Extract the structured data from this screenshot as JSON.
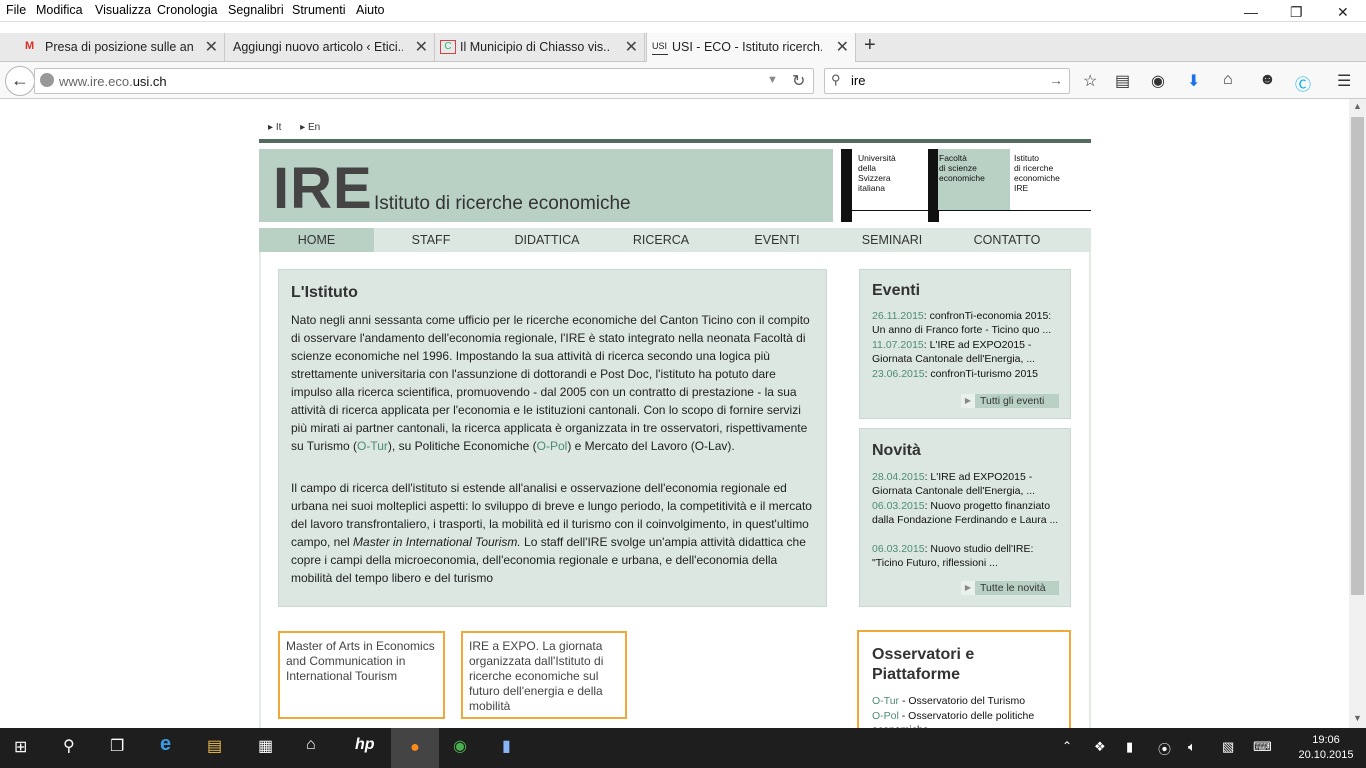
{
  "menu": [
    "File",
    "Modifica",
    "Visualizza",
    "Cronologia",
    "Segnalibri",
    "Strumenti",
    "Aiuto"
  ],
  "window_controls": [
    "—",
    "❐",
    "✕"
  ],
  "tabs": [
    {
      "title": "Presa di posizione sulle an...",
      "icon": "gmail-icon"
    },
    {
      "title": "Aggiungi nuovo articolo ‹ Etici...",
      "icon": "blank-page-icon"
    },
    {
      "title": "Il Municipio di Chiasso vis...",
      "icon": "site-favicon"
    },
    {
      "title": "USI - ECO - Istituto ricerch...",
      "icon": "usi-favicon",
      "active": true
    }
  ],
  "tab_close": "✕",
  "new_tab": "+",
  "address": {
    "prefix": "www.ire.eco.",
    "domain": "usi.ch"
  },
  "search": {
    "value": "ire"
  },
  "toolbar_icons": [
    "star-icon",
    "reading-list-icon",
    "pocket-icon",
    "download-icon",
    "home-icon",
    "chat-icon",
    "skype-icon",
    "menu-icon"
  ],
  "page": {
    "langs": [
      "It",
      "En"
    ],
    "banner": {
      "big": "IRE",
      "subtitle": "Istituto di ricerche economiche"
    },
    "uni": {
      "col1": [
        "Università",
        "della",
        "Svizzera",
        "italiana"
      ],
      "col2": [
        "Facoltà",
        "di scienze",
        "economiche"
      ],
      "col3": [
        "Istituto",
        "di ricerche",
        "economiche",
        "IRE"
      ]
    },
    "nav": [
      "HOME",
      "STAFF",
      "DIDATTICA",
      "RICERCA",
      "EVENTI",
      "SEMINARI",
      "CONTATTO"
    ],
    "main": {
      "title": "L'Istituto",
      "p1_a": "Nato negli anni sessanta come ufficio per le ricerche economiche del Canton Ticino con il compito di osservare l'andamento dell'economia regionale, l'IRE è stato integrato nella neonata Facoltà di scienze economiche nel 1996. Impostando la sua attività di ricerca secondo una logica più strettamente universitaria con l'assunzione di dottorandi e Post Doc, l'istituto ha potuto dare impulso alla ricerca scientifica, promuovendo - dal 2005 con un contratto di prestazione - la sua attività di ricerca applicata per l'economia e le istituzioni cantonali. Con lo scopo di fornire servizi più mirati ai partner cantonali, la ricerca applicata è organizzata in tre osservatori, rispettivamente su Turismo (",
      "link_otur": "O-Tur",
      "p1_b": "), su Politiche Economiche (",
      "link_opol": "O-Pol",
      "p1_c": ") e Mercato del Lavoro (O-Lav).",
      "p2_a": "Il campo di ricerca dell'istituto si estende all'analisi e osservazione dell'economia regionale ed urbana nei suoi molteplici aspetti: lo sviluppo di breve e lungo periodo, la competitività e il mercato del lavoro transfrontaliero, i trasporti, la mobilità ed il turismo con il coinvolgimento, in quest'ultimo campo, nel ",
      "p2_em": "Master in International Tourism.",
      "p2_b": " Lo staff dell'IRE svolge un'ampia attività didattica che copre i campi della microeconomia, dell'economia regionale e urbana, e dell'economia della mobilità del tempo libero e del turismo"
    },
    "eventi": {
      "title": "Eventi",
      "items": [
        {
          "date": "26.11.2015",
          "text": ": confronTi-economia 2015: Un anno di Franco forte - Ticino quo ..."
        },
        {
          "date": "11.07.2015",
          "text": ": L'IRE ad EXPO2015 - Giornata Cantonale dell'Energia, ..."
        },
        {
          "date": "23.06.2015",
          "text": ": confronTi-turismo 2015"
        }
      ],
      "more": "Tutti gli eventi"
    },
    "novita": {
      "title": "Novità",
      "items": [
        {
          "date": "28.04.2015",
          "text": ": L'IRE ad EXPO2015 - Giornata Cantonale dell'Energia, ..."
        },
        {
          "date": "06.03.2015",
          "text": ": Nuovo progetto finanziato dalla Fondazione Ferdinando e Laura ..."
        },
        {
          "date": "06.03.2015",
          "text": ": Nuovo studio dell'IRE: \"Ticino Futuro, riflessioni ..."
        }
      ],
      "more": "Tutte le novità"
    },
    "promos": [
      "Master of Arts in Economics and Communication in International Tourism",
      "IRE a EXPO. La giornata organizzata dall'Istituto di ricerche economiche sul futuro dell'energia e della mobilità"
    ],
    "osservatori": {
      "title": "Osservatori e Piattaforme",
      "items": [
        {
          "code": "O-Tur",
          "text": " - Osservatorio del Turismo"
        },
        {
          "code": "O-Pol",
          "text": " - Osservatorio delle politiche economiche"
        }
      ]
    }
  },
  "taskbar": {
    "time": "19:06",
    "date": "20.10.2015"
  },
  "colors": {
    "accent_green": "#b9d1c5",
    "panel_bg": "#dce7e1",
    "link": "#4d8c73",
    "promo_border": "#f0a83a",
    "header_line": "#556b5e"
  }
}
